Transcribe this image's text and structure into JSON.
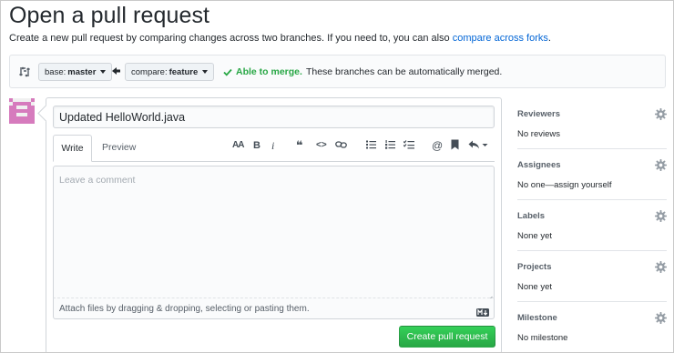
{
  "page": {
    "title": "Open a pull request",
    "subtitle": "Create a new pull request by comparing changes across two branches. If you need to, you can also",
    "subtitle_link": "compare across forks",
    "subtitle_end": "."
  },
  "compare_bar": {
    "base_label": "base:",
    "base_branch": "master",
    "compare_label": "compare:",
    "compare_branch": "feature",
    "merge_status": "Able to merge.",
    "merge_message": "These branches can be automatically merged."
  },
  "form": {
    "title_value": "Updated HelloWorld.java",
    "tab_write": "Write",
    "tab_preview": "Preview",
    "comment_placeholder": "Leave a comment",
    "attach_text": "Attach files by dragging & dropping, selecting or pasting them.",
    "submit_label": "Create pull request"
  },
  "toolbar": {
    "items": [
      "header-icon",
      "bold-icon",
      "italic-icon",
      "quote-icon",
      "code-icon",
      "link-icon",
      "bulleted-list-icon",
      "numbered-list-icon",
      "task-list-icon",
      "mention-icon",
      "saved-reply-icon",
      "reply-icon"
    ],
    "header": "AA",
    "bold": "B",
    "italic": "i",
    "quote": "❝",
    "code": "<>",
    "mention": "@"
  },
  "sidebar": {
    "reviewers_label": "Reviewers",
    "reviewers_value": "No reviews",
    "assignees_label": "Assignees",
    "assignees_value": "No one—assign yourself",
    "labels_label": "Labels",
    "labels_value": "None yet",
    "projects_label": "Projects",
    "projects_value": "None yet",
    "milestone_label": "Milestone",
    "milestone_value": "No milestone"
  },
  "colors": {
    "link": "#0366d6",
    "success": "#28a745",
    "button_green": "#2ea44f",
    "avatar": "#d67bbd"
  }
}
